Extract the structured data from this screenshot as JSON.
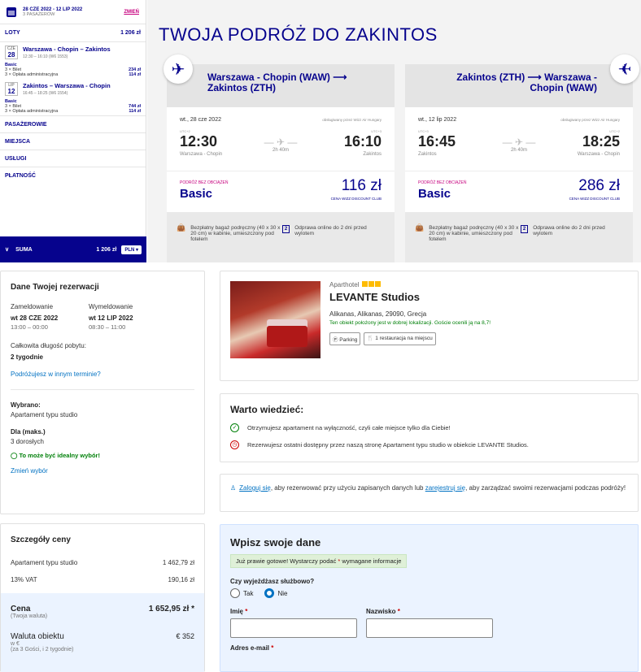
{
  "wizz": {
    "header": {
      "dates": "28 CZE 2022 - 12 LIP 2022",
      "passengers": "3 PASAŻERÓW",
      "change": "ZMIEŃ"
    },
    "flights_section": {
      "label": "LOTY",
      "total": "1 206 zł"
    },
    "outbound": {
      "month": "CZE",
      "day": "28",
      "title": "Warszawa - Chopin – Zakintos",
      "sub": "12:30 – 16:10 (W6 1553)",
      "fare": "Basic",
      "line1_label": "3 × Bilet",
      "line1_value": "234 zł",
      "line2_label": "3 × Opłata administracyjna",
      "line2_value": "114 zł"
    },
    "inbound": {
      "month": "LIP",
      "day": "12",
      "title": "Zakintos – Warszawa - Chopin",
      "sub": "16:45 – 18:25 (W6 1554)",
      "fare": "Basic",
      "line1_label": "3 × Bilet",
      "line1_value": "744 zł",
      "line2_label": "3 × Opłata administracyjna",
      "line2_value": "114 zł"
    },
    "sections": [
      "PASAŻEROWIE",
      "MIEJSCA",
      "USŁUGI",
      "PŁATNOŚĆ"
    ],
    "suma": {
      "label": "SUMA",
      "value": "1 206 zł",
      "currency": "PLN ▾"
    },
    "title": "TWOJA PODRÓŻ DO ZAKINTOS",
    "cards": [
      {
        "route": "Warszawa - Chopin (WAW) ⟶ Zakintos (ZTH)",
        "date": "wt., 28 cze 2022",
        "operated": "obsługiwany przez Wizz Air Hungary",
        "utc_dep": "UTC+2",
        "utc_arr": "UTC+3",
        "dep": "12:30",
        "arr": "16:10",
        "dep_city": "Warszawa - Chopin",
        "arr_city": "Zakintos",
        "duration": "2h 40m",
        "fare_label": "PODRÓŻ BEZ OBCIĄŻEŃ",
        "fare_name": "Basic",
        "price": "116 zł",
        "club": "CENA WIZZ DISCOUNT CLUB",
        "perk1": "Bezpłatny bagaż podręczny (40 x 30 x 20 cm) w kabinie, umieszczony pod fotelem",
        "perk2": "Odprawa online do 2 dni przed wylotem"
      },
      {
        "route": "Zakintos (ZTH) ⟶ Warszawa - Chopin (WAW)",
        "date": "wt., 12 lip 2022",
        "operated": "obsługiwany przez Wizz Air Hungary",
        "utc_dep": "UTC+3",
        "utc_arr": "UTC+2",
        "dep": "16:45",
        "arr": "18:25",
        "dep_city": "Zakintos",
        "arr_city": "Warszawa - Chopin",
        "duration": "2h 40m",
        "fare_label": "PODRÓŻ BEZ OBCIĄŻEŃ",
        "fare_name": "Basic",
        "price": "286 zł",
        "club": "CENA WIZZ DISCOUNT CLUB",
        "perk1": "Bezpłatny bagaż podręczny (40 x 30 x 20 cm) w kabinie, umieszczony pod fotelem",
        "perk2": "Odprawa online do 2 dni przed wylotem"
      }
    ],
    "colors": {
      "brand": "#06038d",
      "accent": "#c6007e"
    }
  },
  "booking": {
    "reservation": {
      "title": "Dane Twojej rezerwacji",
      "checkin_label": "Zameldowanie",
      "checkin_date": "wt 28 CZE 2022",
      "checkin_hours": "13:00 – 00:00",
      "checkout_label": "Wymeldowanie",
      "checkout_date": "wt 12 LIP 2022",
      "checkout_hours": "08:30 – 11:00",
      "stay_label": "Całkowita długość pobytu:",
      "stay_value": "2 tygodnie",
      "other_dates": "Podróżujesz w innym terminie?",
      "chosen_label": "Wybrano:",
      "chosen_value": "Apartament typu studio",
      "for_label": "Dla (maks.)",
      "for_value": "3 dorosłych",
      "ideal": "To może być idealny wybór!",
      "change_choice": "Zmień wybór"
    },
    "price": {
      "title": "Szczegóły ceny",
      "row1_label": "Apartament typu studio",
      "row1_value": "1 462,79 zł",
      "row2_label": "13% VAT",
      "row2_value": "190,16 zł",
      "total_label": "Cena",
      "total_value": "1 652,95 zł *",
      "total_sub": "(Twoja waluta)",
      "local_label": "Waluta obiektu",
      "local_value": "€ 352",
      "local_sub1": "w €",
      "local_sub2": "(za 3 Gości, i 2 tygodnie)"
    },
    "hotel": {
      "type": "Aparthotel",
      "name": "LEVANTE Studios",
      "address": "Alikanas, Alikanas, 29090, Grecja",
      "location_note": "Ten obiekt położony jest w dobrej lokalizacji. Goście ocenili ją na 8,7!",
      "fac1": "Ⓟ Parking",
      "fac2": "🍴 1 restauracja na miejscu"
    },
    "know": {
      "title": "Warto wiedzieć:",
      "item1": "Otrzymujesz apartament na wyłączność, czyli całe miejsce tylko dla Ciebie!",
      "item2": "Rezerwujesz ostatni dostępny przez naszą stronę Apartament typu studio w obiekcie LEVANTE Studios."
    },
    "login": {
      "link1": "Zaloguj się",
      "text1": ", aby rezerwować przy użyciu zapisanych danych lub ",
      "link2": "zarejestruj się",
      "text2": ", aby zarządzać swoimi rezerwacjami podczas podróży!"
    },
    "form": {
      "title": "Wpisz swoje dane",
      "notice_pre": "Już prawie gotowe! Wystarczy podać ",
      "notice_star": "*",
      "notice_post": " wymagane informacje",
      "business_q": "Czy wyjeżdżasz służbowo?",
      "yes": "Tak",
      "no": "Nie",
      "first_name": "Imię",
      "last_name": "Nazwisko",
      "email": "Adres e-mail",
      "star": "*"
    }
  }
}
